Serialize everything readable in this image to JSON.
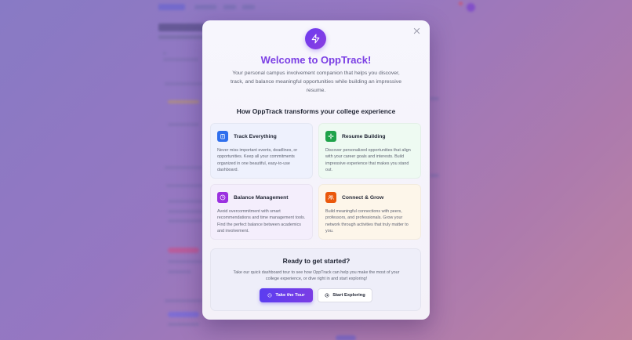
{
  "modal": {
    "title": "Welcome to OppTrack!",
    "subtitle": "Your personal campus involvement companion that helps you discover, track, and balance meaningful opportunities while building an impressive resume.",
    "section_heading": "How OppTrack transforms your college experience",
    "close_icon": "close-icon",
    "hero_icon": "lightning-icon",
    "features": [
      {
        "title": "Track Everything",
        "icon": "clipboard-icon",
        "color": "#2f6fed",
        "description": "Never miss important events, deadlines, or opportunities. Keep all your commitments organized in one beautiful, easy-to-use dashboard."
      },
      {
        "title": "Resume Building",
        "icon": "sparkle-icon",
        "color": "#1fa34a",
        "description": "Discover personalized opportunities that align with your career goals and interests. Build impressive experience that makes you stand out."
      },
      {
        "title": "Balance Management",
        "icon": "clock-icon",
        "color": "#9b30e0",
        "description": "Avoid overcommitment with smart recommendations and time management tools. Find the perfect balance between academics and involvement."
      },
      {
        "title": "Connect & Grow",
        "icon": "people-icon",
        "color": "#ea580c",
        "description": "Build meaningful connections with peers, professors, and professionals. Grow your network through activities that truly matter to you."
      }
    ],
    "cta": {
      "title": "Ready to get started?",
      "description": "Take our quick dashboard tour to see how OppTrack can help you make the most of your college experience, or dive right in and start exploring!",
      "tour_label": "Take the Tour",
      "explore_label": "Start Exploring"
    }
  },
  "colors": {
    "accent": "#7b3fe4",
    "primary_button": "#5b3df0"
  }
}
